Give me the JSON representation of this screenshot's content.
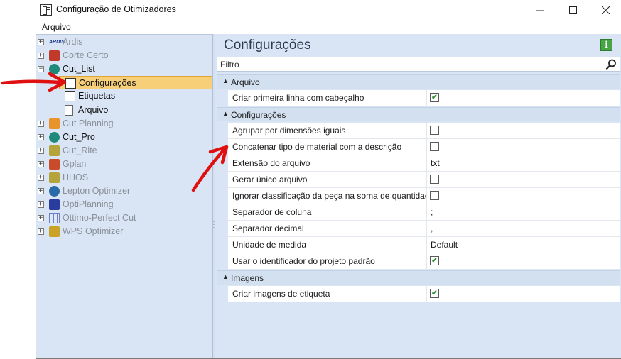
{
  "window": {
    "title": "Configuração de Otimizadores"
  },
  "menu": {
    "items": [
      "Arquivo"
    ]
  },
  "tree": {
    "items": [
      {
        "label": "Ardis",
        "expander": "+",
        "state": "disabled",
        "icon": "ardis-logo-icon",
        "color": "#1b3a8c"
      },
      {
        "label": "Corte Certo",
        "expander": "+",
        "state": "disabled",
        "icon": "corte-certo-icon",
        "color": "#c0392b"
      },
      {
        "label": "Cut_List",
        "expander": "−",
        "state": "enabled",
        "icon": "cut-list-icon",
        "color": "#1f8a7a"
      },
      {
        "label": "Configurações",
        "expander": "",
        "state": "selected",
        "icon": "config-icon",
        "color": "#333333"
      },
      {
        "label": "Etiquetas",
        "expander": "",
        "state": "enabled",
        "icon": "labels-icon",
        "color": "#333333"
      },
      {
        "label": "Arquivo",
        "expander": "",
        "state": "enabled",
        "icon": "file-icon",
        "color": "#666666"
      },
      {
        "label": "Cut Planning",
        "expander": "+",
        "state": "disabled",
        "icon": "cut-planning-icon",
        "color": "#e9932b"
      },
      {
        "label": "Cut_Pro",
        "expander": "+",
        "state": "enabled",
        "icon": "cut-pro-icon",
        "color": "#1f8a7a"
      },
      {
        "label": "Cut_Rite",
        "expander": "+",
        "state": "disabled",
        "icon": "cut-rite-icon",
        "color": "#b5a43b"
      },
      {
        "label": "Gplan",
        "expander": "+",
        "state": "disabled",
        "icon": "gplan-icon",
        "color": "#c94b2a"
      },
      {
        "label": "HHOS",
        "expander": "+",
        "state": "disabled",
        "icon": "hhos-icon",
        "color": "#b5a43b"
      },
      {
        "label": "Lepton Optimizer",
        "expander": "+",
        "state": "disabled",
        "icon": "lepton-icon",
        "color": "#2a6aa8"
      },
      {
        "label": "OptiPlanning",
        "expander": "+",
        "state": "disabled",
        "icon": "optiplanning-icon",
        "color": "#2a3d9e"
      },
      {
        "label": "Ottimo-Perfect Cut",
        "expander": "+",
        "state": "disabled",
        "icon": "ottimo-grid-icon",
        "color": "#6b7fc4"
      },
      {
        "label": "WPS Optimizer",
        "expander": "+",
        "state": "disabled",
        "icon": "wps-icon",
        "color": "#c9a227"
      }
    ]
  },
  "panel": {
    "title": "Configurações",
    "info_label": "i"
  },
  "filter": {
    "placeholder": "Filtro",
    "value": ""
  },
  "grid": {
    "categories": [
      {
        "label": "Arquivo",
        "rows": [
          {
            "name": "Criar primeira linha com cabeçalho",
            "type": "checkbox",
            "checked": true
          }
        ]
      },
      {
        "label": "Configurações",
        "rows": [
          {
            "name": "Agrupar por dimensões iguais",
            "type": "checkbox",
            "checked": false
          },
          {
            "name": "Concatenar tipo de material com a descrição",
            "type": "checkbox",
            "checked": false
          },
          {
            "name": "Extensão do arquivo",
            "type": "text",
            "value": "txt"
          },
          {
            "name": "Gerar único arquivo",
            "type": "checkbox",
            "checked": false
          },
          {
            "name": "Ignorar classificação da peça na soma de quantidade",
            "type": "checkbox",
            "checked": false
          },
          {
            "name": "Separador de coluna",
            "type": "text",
            "value": ";"
          },
          {
            "name": "Separador decimal",
            "type": "text",
            "value": ","
          },
          {
            "name": "Unidade de medida",
            "type": "text",
            "value": "Default"
          },
          {
            "name": "Usar o identificador do projeto padrão",
            "type": "checkbox",
            "checked": true
          }
        ]
      },
      {
        "label": "Imagens",
        "rows": [
          {
            "name": "Criar imagens de etiqueta",
            "type": "checkbox",
            "checked": true
          }
        ]
      }
    ]
  },
  "colors": {
    "accent_selected": "#f7cf79",
    "pane_bg": "#d9e5f4",
    "check_green": "#2c8a2c",
    "annotation_red": "#e01010"
  }
}
